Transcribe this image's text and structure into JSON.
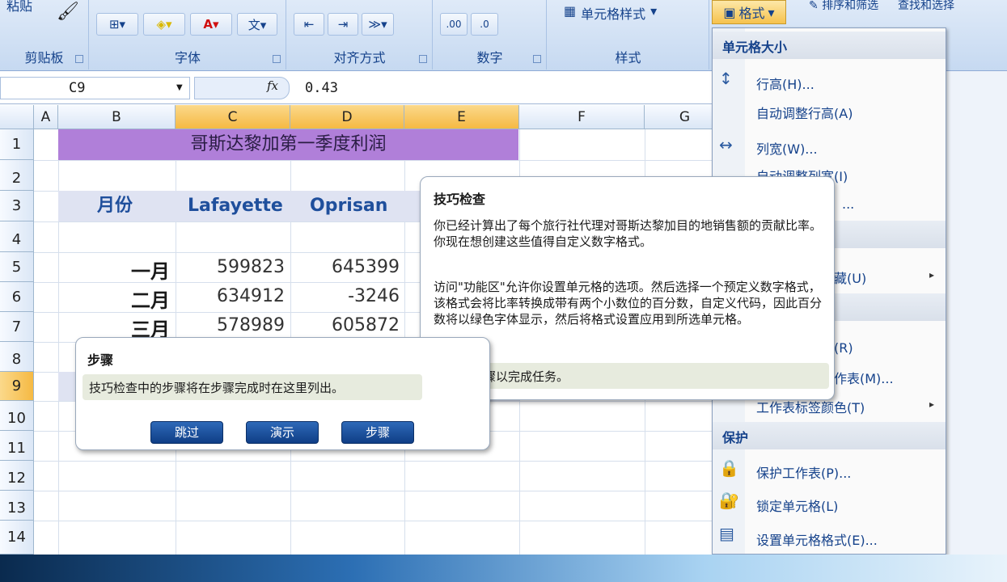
{
  "ribbon": {
    "clipboard_top": "粘贴",
    "groups": {
      "clipboard": "剪贴板",
      "font": "字体",
      "alignment": "对齐方式",
      "number": "数字",
      "styles": "样式"
    },
    "cell_styles": "单元格样式",
    "format": "格式",
    "sort_filter": "排序和筛选",
    "find_select": "查找和选择",
    "colors": {
      "accent": "#15428b",
      "selected": "#f5b943"
    }
  },
  "formula_bar": {
    "name_box": "C9",
    "fx": "fx",
    "value": "0.43"
  },
  "grid": {
    "columns": [
      "A",
      "B",
      "C",
      "D",
      "E",
      "F",
      "G"
    ],
    "rows": [
      "1",
      "2",
      "3",
      "4",
      "5",
      "6",
      "7",
      "8",
      "9",
      "10",
      "11",
      "12",
      "13",
      "14"
    ],
    "title": "哥斯达黎加第一季度利润",
    "headers": {
      "month": "月份",
      "c": "Lafayette",
      "d": "Oprisan"
    },
    "data": [
      {
        "month": "一月",
        "c": "599823",
        "d": "645399"
      },
      {
        "month": "二月",
        "c": "634912",
        "d": "-3246"
      },
      {
        "month": "三月",
        "c": "578989",
        "d": "605872"
      }
    ]
  },
  "format_menu": {
    "cell_size": "单元格大小",
    "row_height": "行高(H)...",
    "autofit_row": "自动调整行高(A)",
    "col_width": "列宽(W)...",
    "autofit_col": "自动调整列宽(I)",
    "default": "...",
    "hide": "隐藏和取消隐藏(U)",
    "rename": "重命名工作表(R)",
    "move_copy": "移动或复制工作表(M)...",
    "tab_color": "工作表标签颜色(T)",
    "protect_section": "保护",
    "protect_sheet": "保护工作表(P)...",
    "lock_cell": "锁定单元格(L)",
    "format_cells": "设置单元格格式(E)..."
  },
  "tip": {
    "title": "技巧检查",
    "p1": "你已经计算出了每个旅行社代理对哥斯达黎加目的地销售额的贡献比率。你现在想创建这些值得自定义数字格式。",
    "p2": "访问\"功能区\"允许你设置单元格的选项。然后选择一个预定义数字格式，该格式会将比率转换成带有两个小数位的百分数，自定义代码，因此百分数将以绿色字体显示，然后将格式设置应用到所选单元格。",
    "action": "执行该步骤以完成任务。"
  },
  "steps": {
    "title": "步骤",
    "message": "技巧检查中的步骤将在步骤完成时在这里列出。",
    "skip": "跳过",
    "demo": "演示",
    "step": "步骤"
  }
}
